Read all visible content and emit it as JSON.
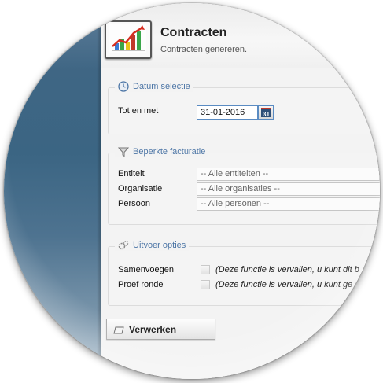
{
  "header": {
    "title": "Contracten",
    "subtitle": "Contracten genereren."
  },
  "date_section": {
    "legend": "Datum selectie",
    "icon": "clock-icon",
    "until_label": "Tot en met",
    "until_value": "31-01-2016",
    "calendar_icon_text": "31"
  },
  "billing_section": {
    "legend": "Beperkte facturatie",
    "icon": "filter-icon",
    "fields": [
      {
        "label": "Entiteit",
        "value": "-- Alle entiteiten --"
      },
      {
        "label": "Organisatie",
        "value": "-- Alle organisaties --"
      },
      {
        "label": "Persoon",
        "value": "-- Alle personen --"
      }
    ]
  },
  "options_section": {
    "legend": "Uitvoer opties",
    "icon": "gears-icon",
    "options": [
      {
        "label": "Samenvoegen",
        "note": "(Deze functie is vervallen, u kunt dit b",
        "checked": false
      },
      {
        "label": "Proef ronde",
        "note": "(Deze functie is vervallen, u kunt ge",
        "checked": false
      }
    ]
  },
  "actions": {
    "process_label": "Verwerken"
  },
  "colors": {
    "accent": "#4d76a6",
    "input_border": "#5a8bc2",
    "side_panel": "#3b6583"
  }
}
